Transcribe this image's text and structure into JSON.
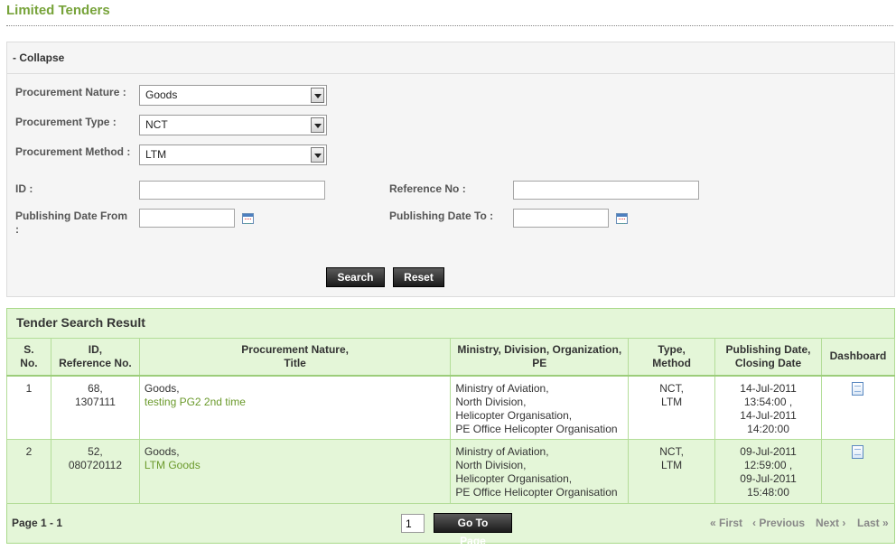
{
  "page": {
    "title": "Limited Tenders"
  },
  "search": {
    "collapse_label": "- Collapse",
    "fields": {
      "nature_label": "Procurement Nature :",
      "nature_value": "Goods",
      "type_label": "Procurement Type :",
      "type_value": "NCT",
      "method_label": "Procurement Method :",
      "method_value": "LTM",
      "id_label": "ID :",
      "id_value": "",
      "ref_label": "Reference No :",
      "ref_value": "",
      "date_from_label": "Publishing Date From :",
      "date_from_value": "",
      "date_to_label": "Publishing Date To :",
      "date_to_value": ""
    },
    "search_button": "Search",
    "reset_button": "Reset"
  },
  "results": {
    "heading": "Tender Search Result",
    "columns": [
      [
        "S.",
        "No."
      ],
      [
        "ID,",
        "Reference No."
      ],
      [
        "Procurement Nature,",
        "Title"
      ],
      [
        "Ministry, Division, Organization,",
        "PE"
      ],
      [
        "Type,",
        "Method"
      ],
      [
        "Publishing Date,",
        "Closing Date"
      ],
      [
        "Dashboard"
      ]
    ],
    "rows": [
      {
        "sno": "1",
        "id": "68,",
        "ref": "1307111",
        "nature": "Goods,",
        "title": "testing PG2 2nd time",
        "ministry": "Ministry of Aviation,",
        "division": "North Division,",
        "organization": "Helicopter Organisation,",
        "pe": "PE Office Helicopter Organisation",
        "type": "NCT,",
        "method": "LTM",
        "pub_date": "14-Jul-2011",
        "pub_time": "13:54:00 ,",
        "close_date": "14-Jul-2011",
        "close_time": "14:20:00",
        "dashboard_icon": "document-icon"
      },
      {
        "sno": "2",
        "id": "52,",
        "ref": "080720112",
        "nature": "Goods,",
        "title": "LTM Goods",
        "ministry": "Ministry of Aviation,",
        "division": "North Division,",
        "organization": "Helicopter Organisation,",
        "pe": "PE Office Helicopter Organisation",
        "type": "NCT,",
        "method": "LTM",
        "pub_date": "09-Jul-2011",
        "pub_time": "12:59:00 ,",
        "close_date": "09-Jul-2011",
        "close_time": "15:48:00",
        "dashboard_icon": "document-icon"
      }
    ]
  },
  "pager": {
    "label": "Page 1 - 1",
    "page_input": "1",
    "go_button": "Go To Page",
    "first": "« First",
    "previous": "‹ Previous",
    "next": "Next ›",
    "last": "Last »"
  },
  "colors": {
    "title": "#77a33a",
    "link": "#6b9a2c",
    "result_bg": "#e4f6d8"
  }
}
